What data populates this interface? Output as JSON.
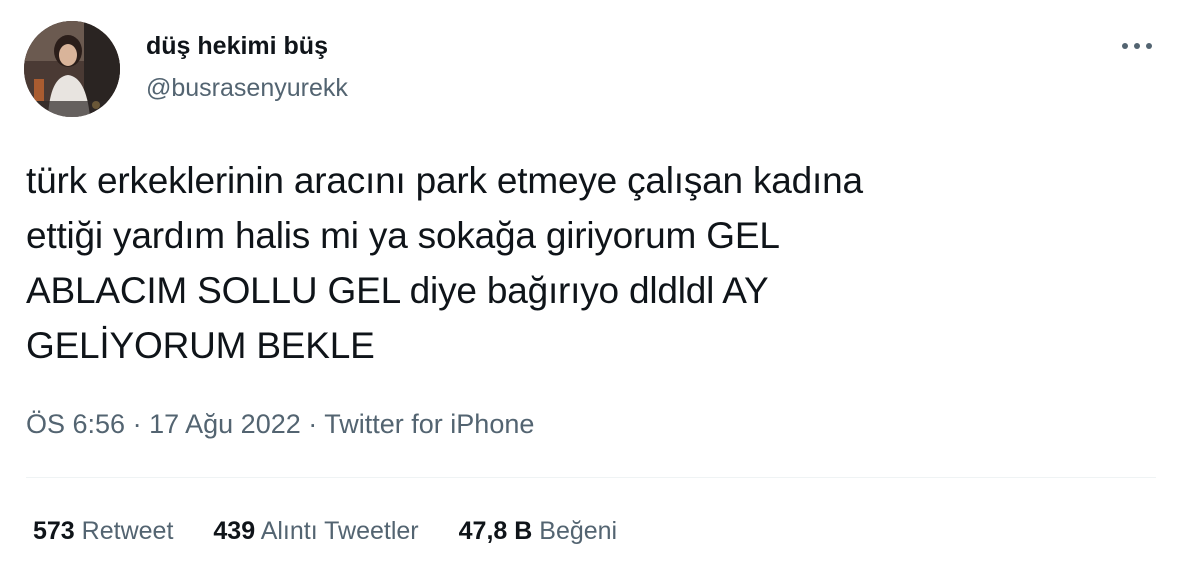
{
  "author": {
    "display_name": "düş hekimi büş",
    "handle": "@busrasenyurekk"
  },
  "tweet": {
    "text": "türk erkeklerinin aracını park etmeye çalışan kadına\nettiği yardım halis mi ya sokağa giriyorum GEL\nABLACIM SOLLU GEL diye bağırıyo dldldl AY\nGELİYORUM BEKLE"
  },
  "meta": {
    "time": "ÖS 6:56",
    "separator": "·",
    "date": "17 Ağu 2022",
    "source": "Twitter for iPhone"
  },
  "stats": [
    {
      "num": "573",
      "label": "Retweet"
    },
    {
      "num": "439",
      "label": "Alıntı Tweetler"
    },
    {
      "num": "47,8 B",
      "label": "Beğeni"
    }
  ],
  "icons": {
    "more": "more-horizontal-icon"
  },
  "colors": {
    "text": "#0f1419",
    "secondary": "#536471",
    "divider": "#eff3f4"
  }
}
